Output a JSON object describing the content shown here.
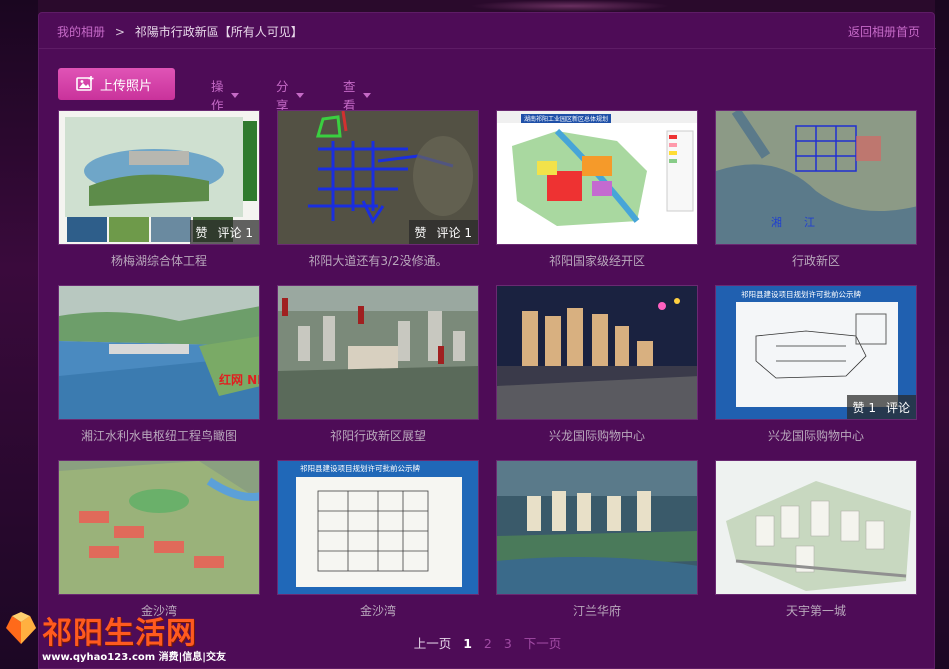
{
  "breadcrumb": {
    "root": "我的相册",
    "separator": ">",
    "current": "祁陽市行政新區【所有人可见】"
  },
  "back_link": "返回相册首页",
  "toolbar": {
    "upload_label": "上传照片",
    "menus": [
      "操作",
      "分享",
      "查看"
    ]
  },
  "photos": [
    {
      "caption": "杨梅湖综合体工程",
      "likes_label": "赞",
      "comments_label": "评论 1"
    },
    {
      "caption": "祁阳大道还有3/2没修通。",
      "likes_label": "赞",
      "comments_label": "评论 1"
    },
    {
      "caption": "祁阳国家级经开区"
    },
    {
      "caption": "行政新区"
    },
    {
      "caption": "湘江水利水电枢纽工程鸟瞰图",
      "watermark": "红网 NET.CN"
    },
    {
      "caption": "祁阳行政新区展望"
    },
    {
      "caption": "兴龙国际购物中心"
    },
    {
      "caption": "兴龙国际购物中心",
      "likes_label": "赞 1",
      "comments_label": "评论"
    },
    {
      "caption": "金沙湾"
    },
    {
      "caption": "金沙湾",
      "sign_title": "祁阳县建设项目规划许可批前公示牌"
    },
    {
      "caption": "汀兰华府"
    },
    {
      "caption": "天宇第一城"
    }
  ],
  "photo_texts": {
    "map_title": "湖南祁阳工业园区新区总体规划",
    "sign_title_8": "祁阳县建设项目规划许可批前公示牌"
  },
  "pager": {
    "prev": "上一页",
    "pages": [
      "1",
      "2",
      "3"
    ],
    "current": "1",
    "next": "下一页"
  },
  "logo": {
    "title": "祁阳生活网",
    "subtitle": "www.qyhao123.com 消费|信息|交友"
  },
  "colors": {
    "panel": "#4e0c57",
    "accent": "#c9329b",
    "link": "#c66ac8",
    "caption": "#b9a8bc"
  }
}
